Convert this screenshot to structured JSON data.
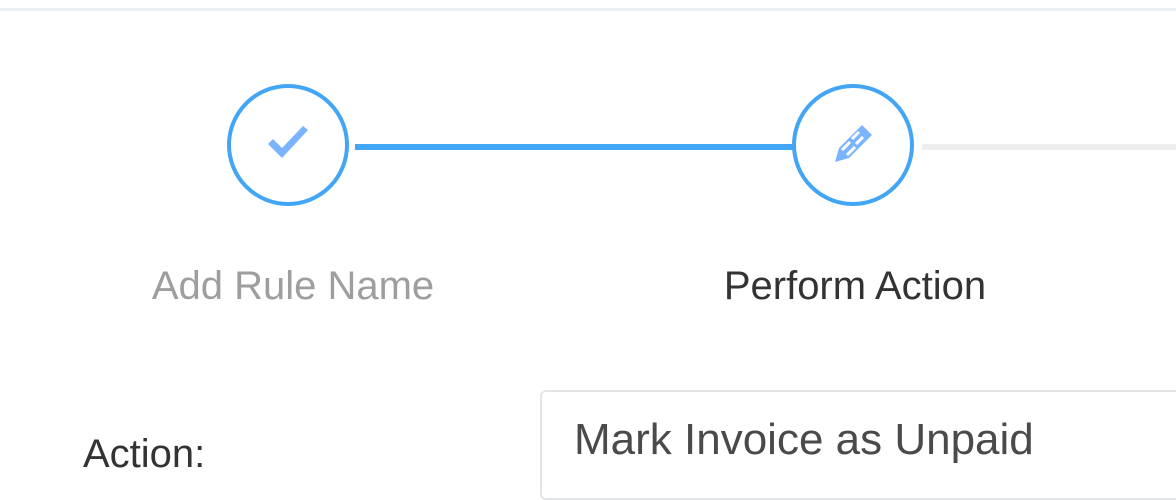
{
  "colors": {
    "accent": "#42a5f5",
    "icon_fill": "#7ab4ff",
    "pending_line": "#eeeeee",
    "label_muted": "#9e9e9e",
    "label_active": "#333333"
  },
  "stepper": {
    "steps": [
      {
        "label": "Add Rule Name",
        "icon": "check-icon",
        "state": "completed"
      },
      {
        "label": "Perform Action",
        "icon": "pencil-icon",
        "state": "active"
      }
    ]
  },
  "form": {
    "action": {
      "label": "Action:",
      "value": "Mark Invoice as Unpaid"
    }
  }
}
